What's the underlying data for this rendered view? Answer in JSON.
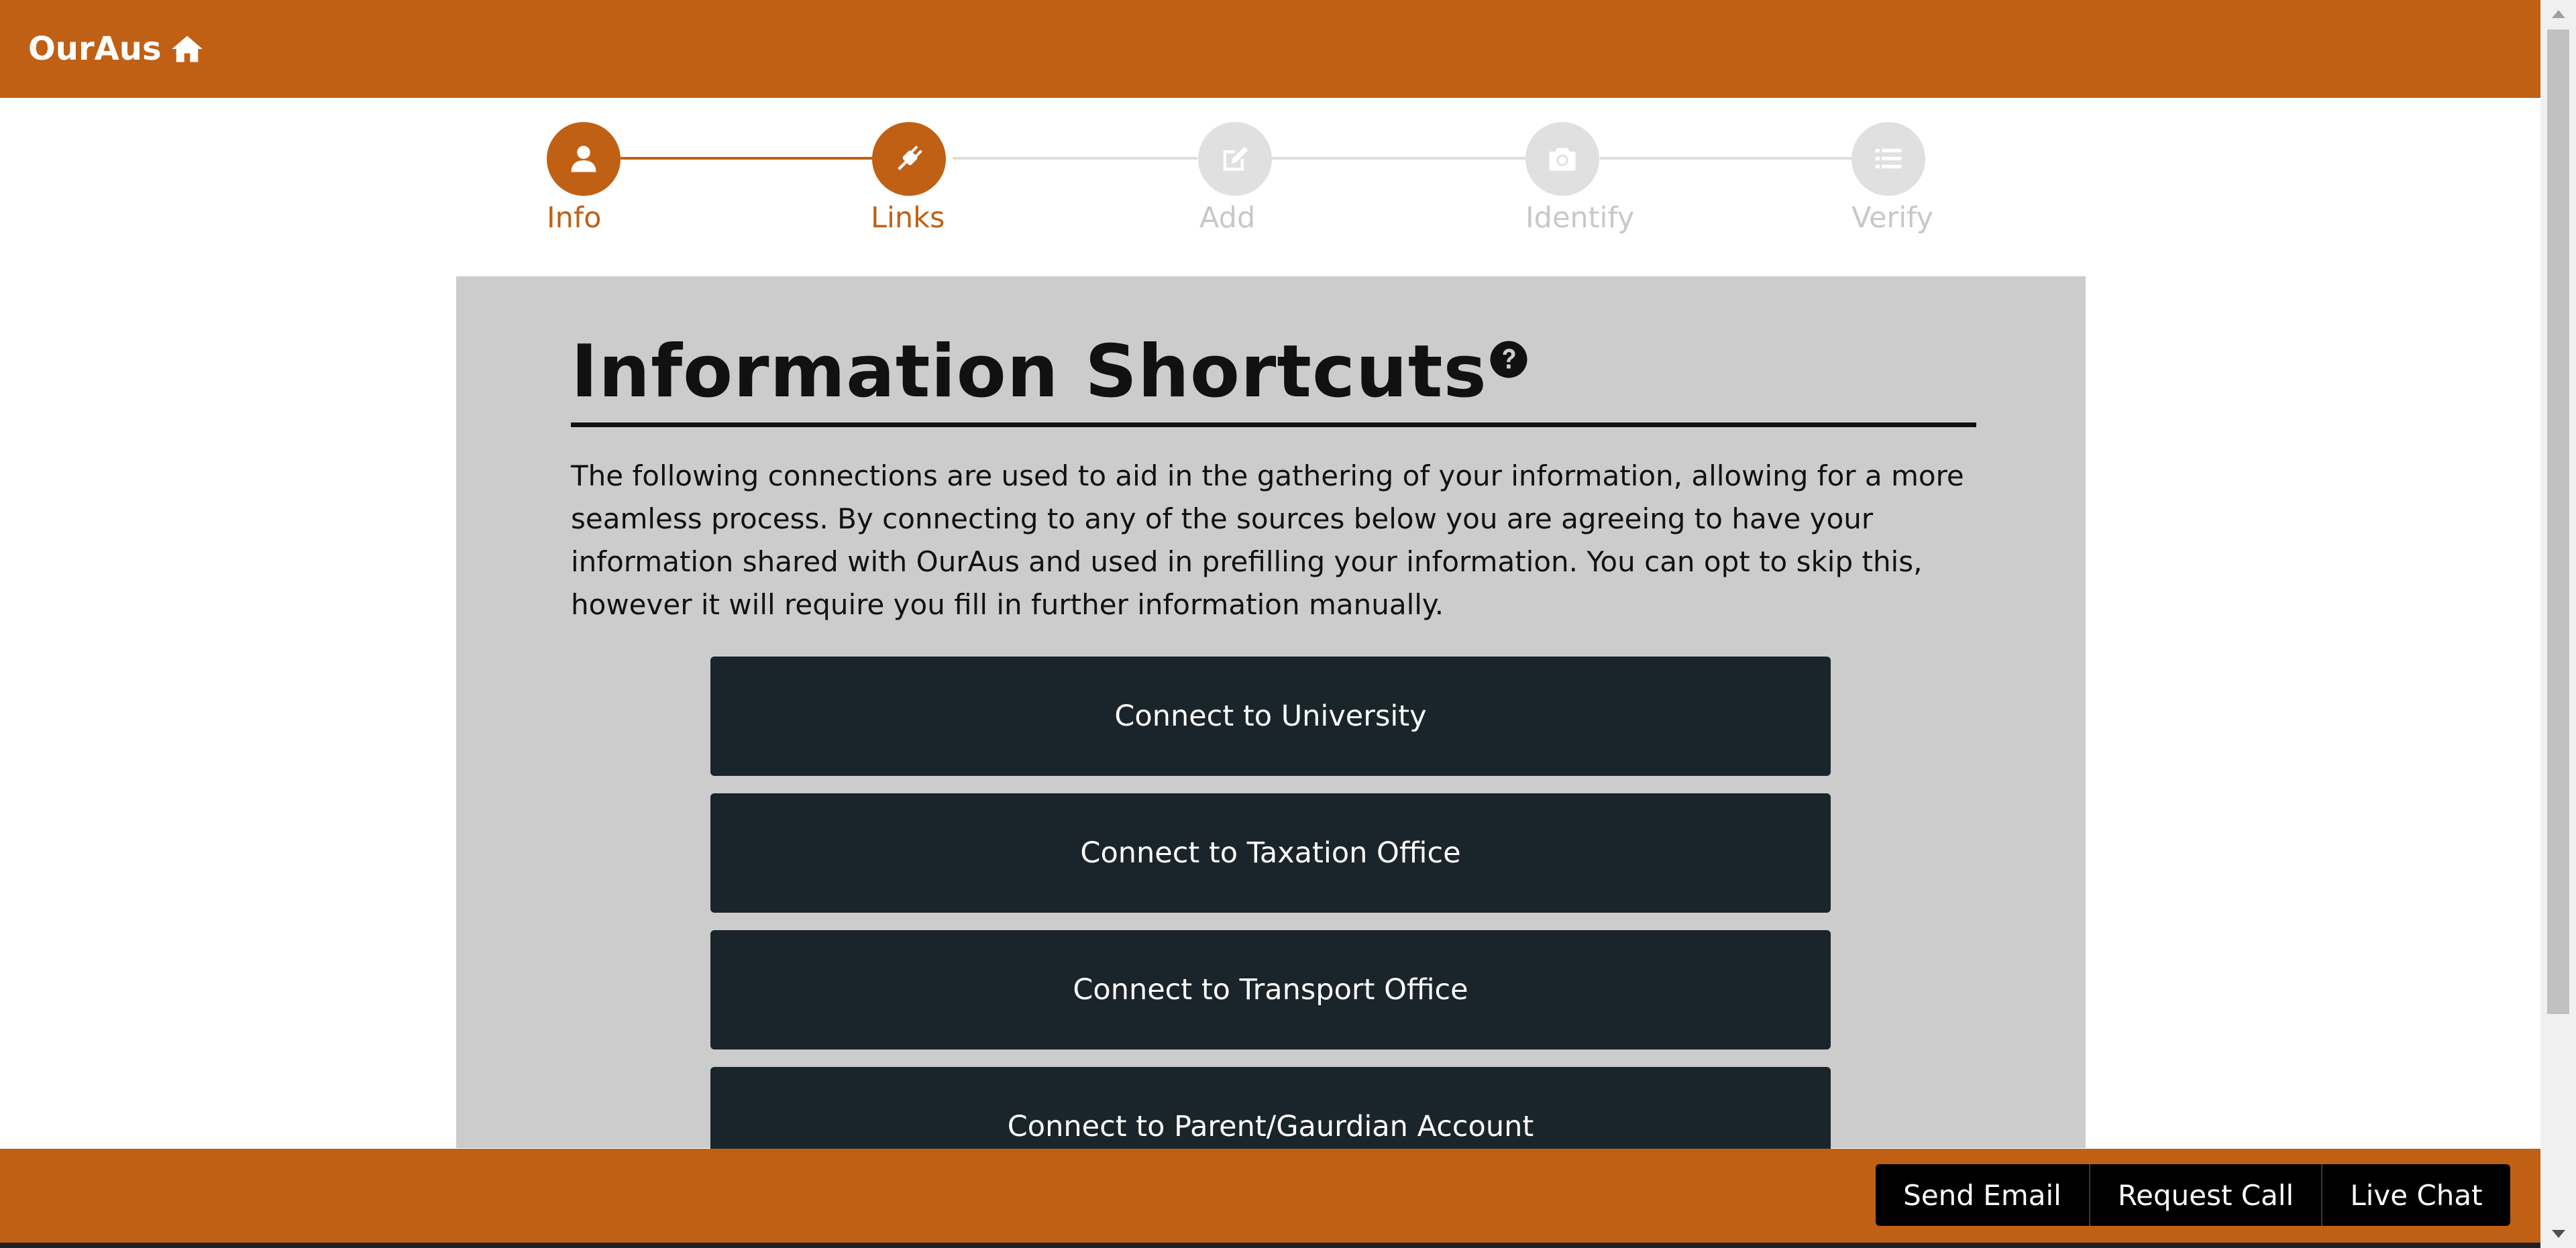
{
  "header": {
    "brand": "OurAus",
    "home_icon": "home-icon",
    "color": "#c06015"
  },
  "stepper": {
    "steps": [
      {
        "label": "Info",
        "icon": "user-icon",
        "state": "active"
      },
      {
        "label": "Links",
        "icon": "plug-icon",
        "state": "active"
      },
      {
        "label": "Add",
        "icon": "edit-icon",
        "state": "inactive"
      },
      {
        "label": "Identify",
        "icon": "camera-icon",
        "state": "inactive"
      },
      {
        "label": "Verify",
        "icon": "list-icon",
        "state": "inactive"
      }
    ]
  },
  "main": {
    "title": "Information Shortcuts",
    "help_icon": "question-circle-icon",
    "intro": "The following connections are used to aid in the gathering of your information, allowing for a more seamless process. By connecting to any of the sources below you are agreeing to have your information shared with OurAus and used in prefilling your information. You can opt to skip this, however it will require you fill in further information manually.",
    "buttons": [
      {
        "label": "Connect to University"
      },
      {
        "label": "Connect to Taxation Office"
      },
      {
        "label": "Connect to Transport Office"
      },
      {
        "label": "Connect to Parent/Gaurdian Account"
      }
    ]
  },
  "footer": {
    "send_email": "Send Email",
    "request_call": "Request Call",
    "live_chat": "Live Chat"
  },
  "colors": {
    "accent": "#c06015",
    "button_dark": "#1a252b",
    "card_bg": "#cccccc",
    "inactive": "#e0e0e0"
  }
}
